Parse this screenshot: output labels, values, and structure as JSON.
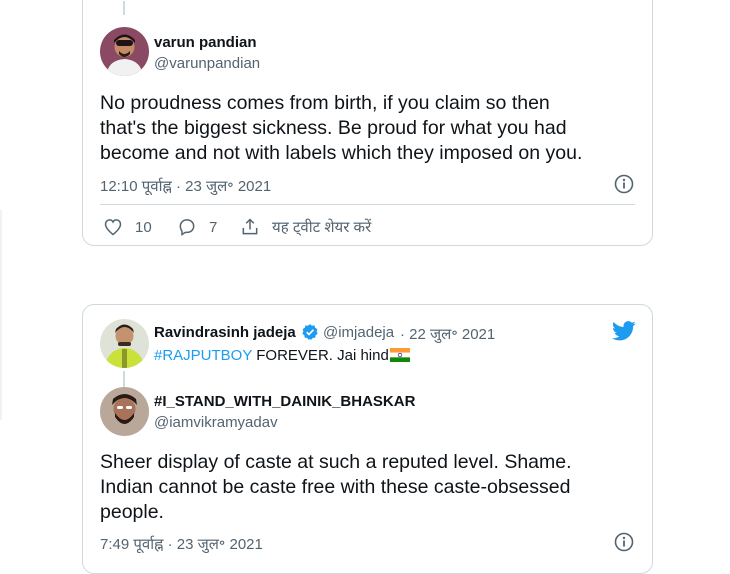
{
  "tweet1": {
    "author_name": "varun pandian",
    "author_handle": "@varunpandian",
    "text_line1": "No proudness comes from birth, if you claim so then",
    "text_line2": "that's the biggest sickness. Be proud for what you had",
    "text_line3": "become and not with labels which they imposed on you.",
    "timestamp": "12:10 पूर्वाह्न · 23 जुल॰ 2021",
    "likes": "10",
    "replies": "7",
    "share_label": "यह ट्वीट शेयर करें"
  },
  "tweet2": {
    "quoted": {
      "author_name": "Ravindrasinh jadeja",
      "author_handle": "@imjadeja",
      "date": "· 22 जुल॰ 2021",
      "hashtag": "#RAJPUTBOY",
      "text_rest": " FOREVER. Jai hind"
    },
    "author_name": "#I_STAND_WITH_DAINIK_BHASKAR",
    "author_handle": "@iamvikramyadav",
    "text_line1": "Sheer display of caste at such a reputed level. Shame.",
    "text_line2": "Indian cannot be caste free with these caste-obsessed",
    "text_line3": "people.",
    "timestamp": "7:49 पूर्वाह्न · 23 जुल॰ 2021"
  },
  "colors": {
    "accent": "#1d9bf0",
    "verified": "#1d9bf0",
    "border": "#cfd9de",
    "muted": "#536471"
  }
}
